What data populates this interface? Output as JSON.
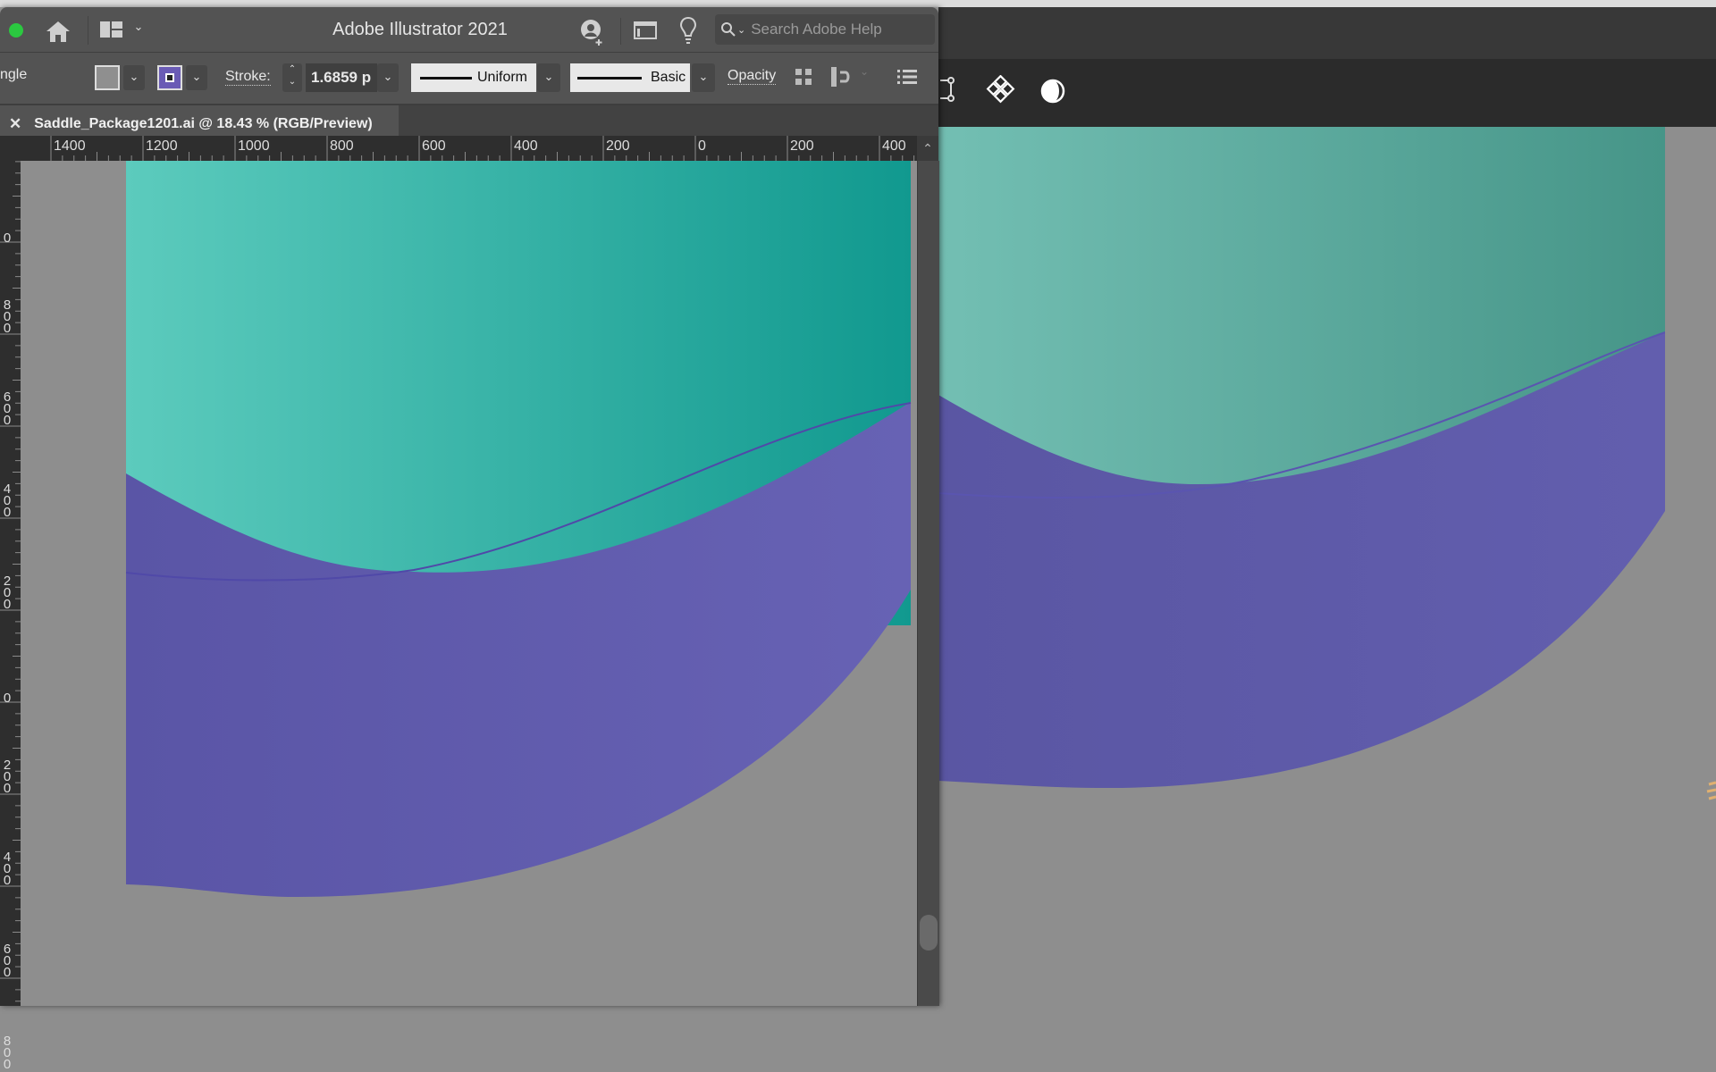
{
  "app": {
    "title": "Adobe Illustrator 2021",
    "window_dot_color": "#2bc840"
  },
  "titlebar": {
    "home_icon": "home-icon",
    "workspace_icon": "workspace-layout-icon",
    "search_placeholder": "Search Adobe Help",
    "icons": [
      "user-add-icon",
      "screen-mode-icon",
      "lightbulb-icon"
    ]
  },
  "controlbar": {
    "selection_type": "ngle",
    "fill_color": "#8f8f8f",
    "stroke_color": "#6a5bb5",
    "stroke_label": "Stroke:",
    "stroke_value": "1.6859 p",
    "variable_width_profile": "Uniform",
    "brush_definition": "Basic",
    "opacity_label": "Opacity",
    "icons": [
      "align-grid-icon",
      "snap-icon",
      "panel-menu-icon"
    ]
  },
  "document_tab": {
    "label": "Saddle_Package1201.ai @ 18.43 % (RGB/Preview)",
    "close_icon": "close-icon"
  },
  "ruler_horizontal": {
    "labels": [
      "1400",
      "1200",
      "1000",
      "800",
      "600",
      "400",
      "200",
      "0",
      "200",
      "400"
    ]
  },
  "ruler_vertical": {
    "labels": [
      "0",
      "800",
      "600",
      "400",
      "200",
      "0",
      "200",
      "400",
      "600",
      "800"
    ]
  },
  "artwork": {
    "teal_light": "#5ccbbd",
    "teal_dark": "#11998f",
    "purple_left": "#5a55a6",
    "purple_right": "#6762b4",
    "pasteboard": "#8e8e8e"
  },
  "right_window": {
    "toolbar_icons": [
      "artboard-icon",
      "components-icon",
      "contrast-icon"
    ],
    "teal_light": "#73bfb3",
    "teal_dark": "#469588",
    "purple": "#5f5aa8"
  }
}
